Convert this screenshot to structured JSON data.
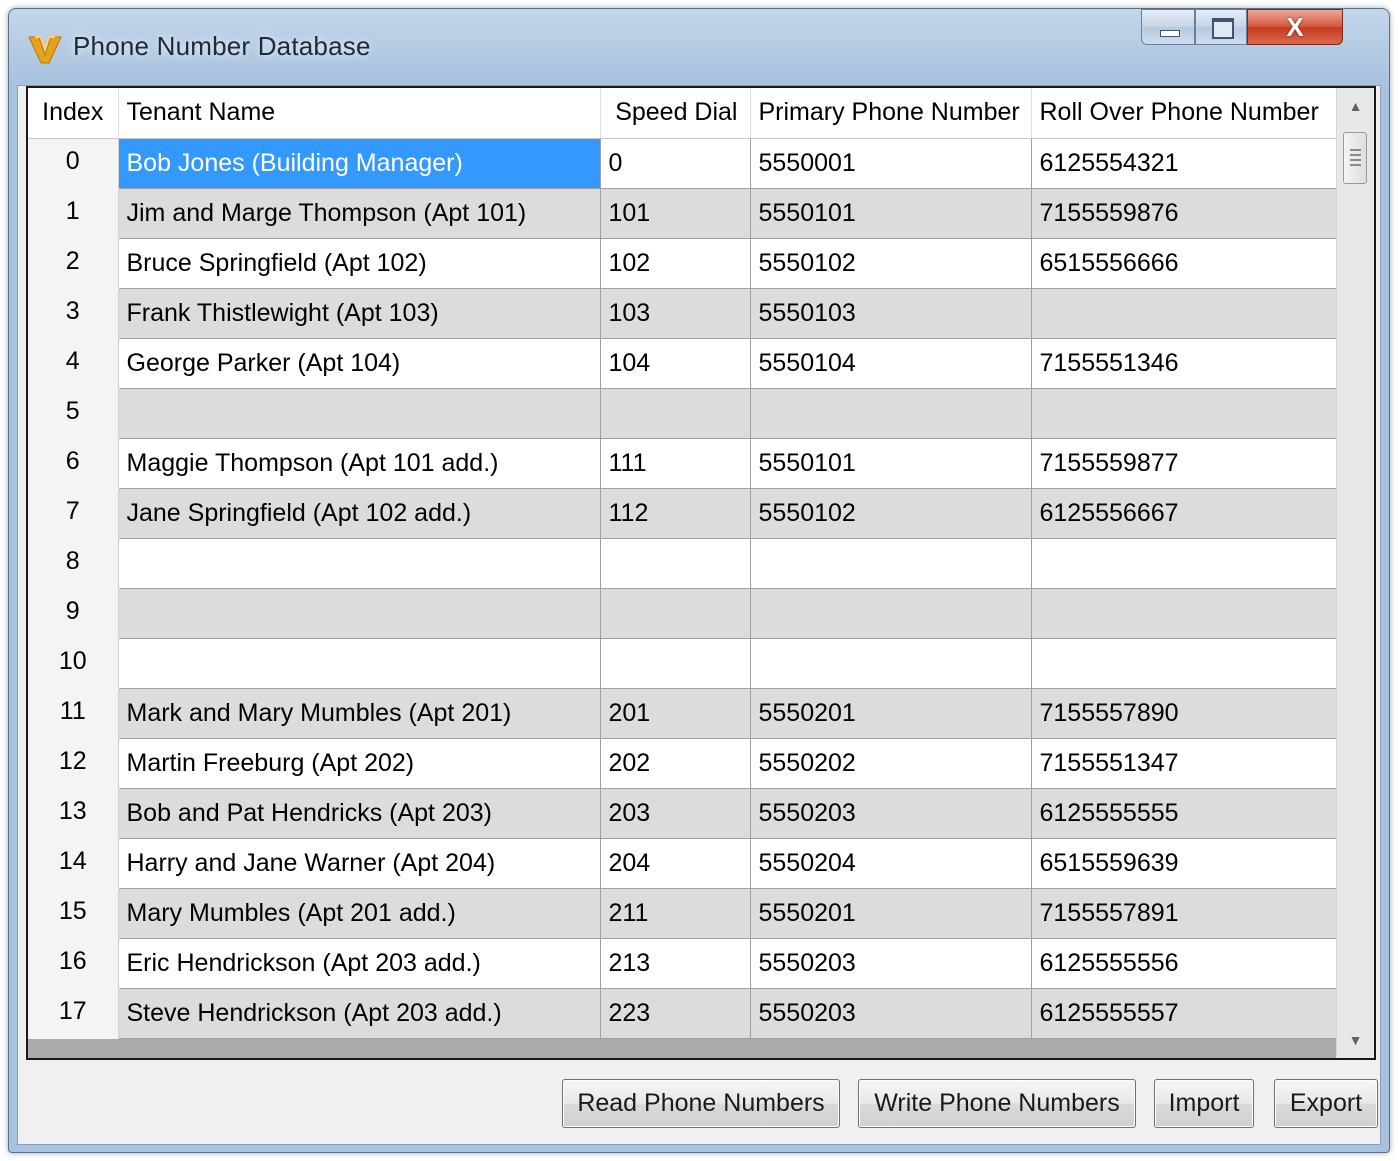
{
  "window": {
    "title": "Phone Number Database",
    "close_glyph": "X"
  },
  "grid": {
    "columns": [
      "Index",
      "Tenant Name",
      "Speed Dial",
      "Primary Phone Number",
      "Roll Over Phone Number"
    ],
    "rows": [
      {
        "index": "0",
        "name": "Bob Jones (Building Manager)",
        "speed": "0",
        "primary": "5550001",
        "rollover": "6125554321"
      },
      {
        "index": "1",
        "name": "Jim and Marge Thompson (Apt 101)",
        "speed": "101",
        "primary": "5550101",
        "rollover": "7155559876"
      },
      {
        "index": "2",
        "name": "Bruce Springfield (Apt 102)",
        "speed": "102",
        "primary": "5550102",
        "rollover": "6515556666"
      },
      {
        "index": "3",
        "name": "Frank Thistlewight (Apt 103)",
        "speed": "103",
        "primary": "5550103",
        "rollover": ""
      },
      {
        "index": "4",
        "name": "George Parker (Apt 104)",
        "speed": "104",
        "primary": "5550104",
        "rollover": "7155551346"
      },
      {
        "index": "5",
        "name": "",
        "speed": "",
        "primary": "",
        "rollover": ""
      },
      {
        "index": "6",
        "name": "Maggie Thompson (Apt 101 add.)",
        "speed": "111",
        "primary": "5550101",
        "rollover": "7155559877"
      },
      {
        "index": "7",
        "name": "Jane Springfield (Apt 102 add.)",
        "speed": "112",
        "primary": "5550102",
        "rollover": "6125556667"
      },
      {
        "index": "8",
        "name": "",
        "speed": "",
        "primary": "",
        "rollover": ""
      },
      {
        "index": "9",
        "name": "",
        "speed": "",
        "primary": "",
        "rollover": ""
      },
      {
        "index": "10",
        "name": "",
        "speed": "",
        "primary": "",
        "rollover": ""
      },
      {
        "index": "11",
        "name": "Mark and Mary Mumbles (Apt 201)",
        "speed": "201",
        "primary": "5550201",
        "rollover": "7155557890"
      },
      {
        "index": "12",
        "name": "Martin Freeburg (Apt 202)",
        "speed": "202",
        "primary": "5550202",
        "rollover": "7155551347"
      },
      {
        "index": "13",
        "name": "Bob and Pat Hendricks (Apt 203)",
        "speed": "203",
        "primary": "5550203",
        "rollover": "6125555555"
      },
      {
        "index": "14",
        "name": "Harry and Jane Warner (Apt 204)",
        "speed": "204",
        "primary": "5550204",
        "rollover": "6515559639"
      },
      {
        "index": "15",
        "name": "Mary Mumbles (Apt 201 add.)",
        "speed": "211",
        "primary": "5550201",
        "rollover": "7155557891"
      },
      {
        "index": "16",
        "name": "Eric Hendrickson (Apt 203 add.)",
        "speed": "213",
        "primary": "5550203",
        "rollover": "6125555556"
      },
      {
        "index": "17",
        "name": "Steve Hendrickson (Apt 203 add.)",
        "speed": "223",
        "primary": "5550203",
        "rollover": "6125555557"
      }
    ],
    "selected_cell": {
      "row": 0,
      "column": "Tenant Name"
    }
  },
  "buttons": {
    "read": "Read Phone Numbers",
    "write": "Write Phone Numbers",
    "import": "Import",
    "export": "Export"
  },
  "icons": {
    "app": "v-logo-icon",
    "minimize": "minimize-icon",
    "maximize": "maximize-icon",
    "close": "close-icon",
    "scroll_up": "scroll-up-arrow-icon",
    "scroll_down": "scroll-down-arrow-icon"
  },
  "colors": {
    "selection": "#3399ff",
    "row_even": "#ffffff",
    "row_odd": "#dcdcdc",
    "logo": "#e8a21a"
  }
}
